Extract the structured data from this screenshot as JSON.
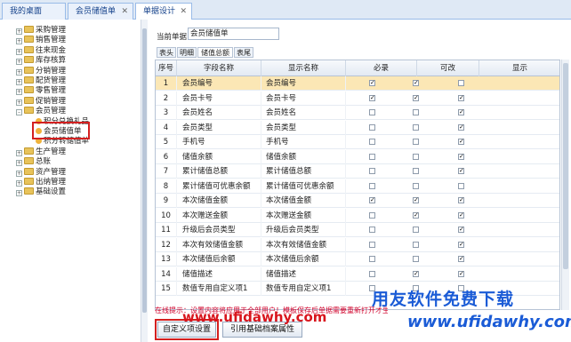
{
  "tabs": [
    {
      "label": "我的桌面",
      "closable": false,
      "active": false
    },
    {
      "label": "会员储值单",
      "closable": true,
      "active": false
    },
    {
      "label": "单据设计",
      "closable": true,
      "active": true
    }
  ],
  "tree": [
    {
      "label": "采购管理",
      "type": "folder",
      "expanded": false
    },
    {
      "label": "销售管理",
      "type": "folder",
      "expanded": false
    },
    {
      "label": "往来现金",
      "type": "folder",
      "expanded": false
    },
    {
      "label": "库存核算",
      "type": "folder",
      "expanded": false
    },
    {
      "label": "分销管理",
      "type": "folder",
      "expanded": false
    },
    {
      "label": "配货管理",
      "type": "folder",
      "expanded": false
    },
    {
      "label": "零售管理",
      "type": "folder",
      "expanded": false
    },
    {
      "label": "促销管理",
      "type": "folder",
      "expanded": false
    },
    {
      "label": "会员管理",
      "type": "folder",
      "expanded": true
    },
    {
      "label": "积分兑换礼品",
      "type": "leaf"
    },
    {
      "label": "会员储值单",
      "type": "leaf",
      "selected": true
    },
    {
      "label": "积分转储值单",
      "type": "leaf"
    },
    {
      "label": "生产管理",
      "type": "folder",
      "expanded": false
    },
    {
      "label": "总账",
      "type": "folder",
      "expanded": false
    },
    {
      "label": "资产管理",
      "type": "folder",
      "expanded": false
    },
    {
      "label": "出纳管理",
      "type": "folder",
      "expanded": false
    },
    {
      "label": "基础设置",
      "type": "folder",
      "expanded": false
    }
  ],
  "current_doc": {
    "label": "当前单据",
    "value": "会员储值单"
  },
  "subtabs": [
    {
      "label": "表头",
      "active": false
    },
    {
      "label": "明细",
      "active": false
    },
    {
      "label": "储值总额",
      "active": true
    },
    {
      "label": "表尾",
      "active": false
    }
  ],
  "grid": {
    "columns": [
      "序号",
      "字段名称",
      "显示名称",
      "必录",
      "可改",
      "显示"
    ],
    "rows": [
      {
        "no": "1",
        "field": "会员编号",
        "display": "会员编号",
        "required": true,
        "editable": true,
        "visible": false,
        "selected": true
      },
      {
        "no": "2",
        "field": "会员卡号",
        "display": "会员卡号",
        "required": true,
        "editable": true,
        "visible": true
      },
      {
        "no": "3",
        "field": "会员姓名",
        "display": "会员姓名",
        "required": false,
        "editable": false,
        "visible": true
      },
      {
        "no": "4",
        "field": "会员类型",
        "display": "会员类型",
        "required": false,
        "editable": false,
        "visible": true
      },
      {
        "no": "5",
        "field": "手机号",
        "display": "手机号",
        "required": false,
        "editable": false,
        "visible": true
      },
      {
        "no": "6",
        "field": "储值余额",
        "display": "储值余额",
        "required": false,
        "editable": false,
        "visible": true
      },
      {
        "no": "7",
        "field": "累计储值总额",
        "display": "累计储值总额",
        "required": false,
        "editable": false,
        "visible": true
      },
      {
        "no": "8",
        "field": "累计储值可优惠余额",
        "display": "累计储值可优惠余额",
        "required": false,
        "editable": false,
        "visible": false
      },
      {
        "no": "9",
        "field": "本次储值金额",
        "display": "本次储值金额",
        "required": true,
        "editable": true,
        "visible": true
      },
      {
        "no": "10",
        "field": "本次赠送金额",
        "display": "本次赠送金额",
        "required": false,
        "editable": true,
        "visible": true
      },
      {
        "no": "11",
        "field": "升级后会员类型",
        "display": "升级后会员类型",
        "required": false,
        "editable": false,
        "visible": true
      },
      {
        "no": "12",
        "field": "本次有效储值金额",
        "display": "本次有效储值金额",
        "required": false,
        "editable": false,
        "visible": true
      },
      {
        "no": "13",
        "field": "本次储值后余额",
        "display": "本次储值后余额",
        "required": false,
        "editable": false,
        "visible": true
      },
      {
        "no": "14",
        "field": "储值描述",
        "display": "储值描述",
        "required": false,
        "editable": true,
        "visible": true
      },
      {
        "no": "15",
        "field": "数值专用自定义项1",
        "display": "数值专用自定义项1",
        "required": false,
        "editable": false,
        "visible": false
      }
    ]
  },
  "hint": "在线提示：设置内容将应用于全部用户！模板保存后单据需要重新打开才生",
  "buttons": {
    "custom": "自定义项设置",
    "ref": "引用基础档案属性"
  },
  "watermarks": {
    "site_red": "www.ufidawhy.com",
    "brand": "用友软件免费下载",
    "site_blue": "www.ufidawhy.com"
  },
  "colors": {
    "accent": "#15428b",
    "highlight": "#d42020",
    "selected_row": "#fbe7b5",
    "hint": "#d0002a",
    "brand_blue": "#1a5bd6"
  }
}
